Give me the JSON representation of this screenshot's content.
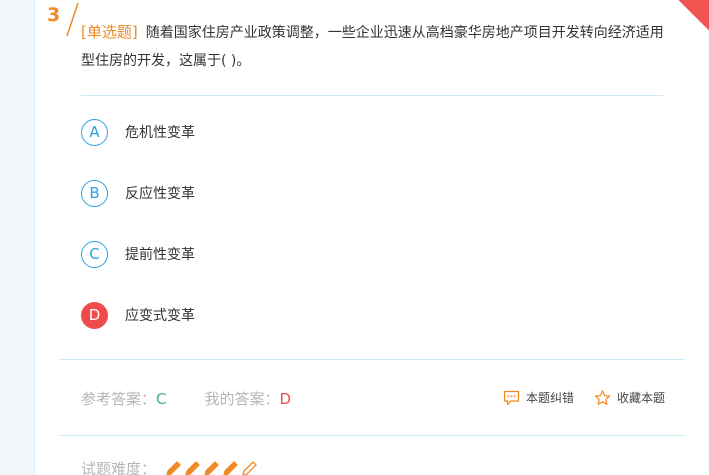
{
  "question": {
    "number": "3",
    "type_label": "[单选题]",
    "text": "随着国家住房产业政策调整，一些企业迅速从高档豪华房地产项目开发转向经济适用型住房的开发，这属于( )。"
  },
  "options": [
    {
      "letter": "A",
      "text": "危机性变革",
      "selected": false
    },
    {
      "letter": "B",
      "text": "反应性变革",
      "selected": false
    },
    {
      "letter": "C",
      "text": "提前性变革",
      "selected": false
    },
    {
      "letter": "D",
      "text": "应变式变革",
      "selected": true
    }
  ],
  "answers": {
    "reference_label": "参考答案：",
    "reference_value": "C",
    "mine_label": "我的答案：",
    "mine_value": "D"
  },
  "actions": {
    "report_label": "本题纠错",
    "favorite_label": "收藏本题"
  },
  "difficulty": {
    "label": "试题难度：",
    "level": 4,
    "max": 5
  },
  "colors": {
    "accent_orange": "#f08a24",
    "accent_blue": "#2aa3e0",
    "wrong_red": "#ef4b4b",
    "correct_green": "#3cb48a"
  }
}
